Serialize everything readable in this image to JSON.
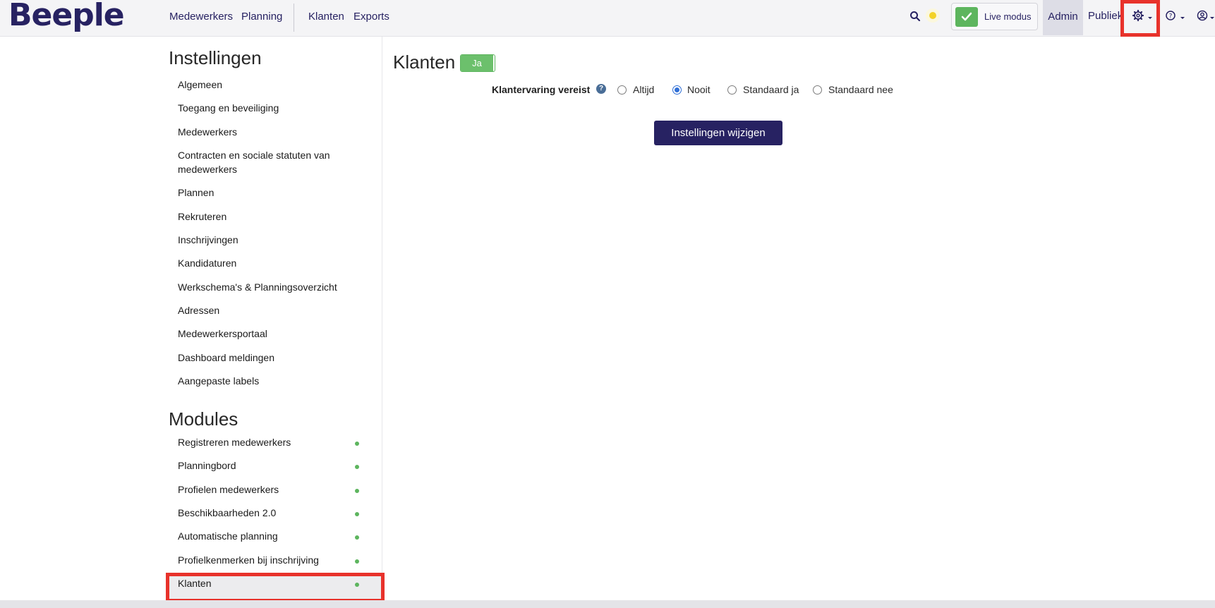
{
  "header": {
    "logo": "Beeple",
    "nav": [
      "Medewerkers",
      "Planning",
      "Klanten",
      "Exports"
    ],
    "live_mode_label": "Live modus",
    "admin_label": "Admin",
    "public_label": "Publiek",
    "icons": [
      "search-icon",
      "theme-indicator-icon",
      "check-icon",
      "gear-icon",
      "help-icon",
      "user-account-icon",
      "chevron-down-icon"
    ]
  },
  "sidebar": {
    "settings_heading": "Instellingen",
    "settings_items": [
      "Algemeen",
      "Toegang en beveiliging",
      "Medewerkers",
      "Contracten en sociale statuten van medewerkers",
      "Plannen",
      "Rekruteren",
      "Inschrijvingen",
      "Kandidaturen",
      "Werkschema's & Planningsoverzicht",
      "Adressen",
      "Medewerkersportaal",
      "Dashboard meldingen",
      "Aangepaste labels"
    ],
    "modules_heading": "Modules",
    "module_items": [
      "Registreren medewerkers",
      "Planningbord",
      "Profielen medewerkers",
      "Beschikbaarheden 2.0",
      "Automatische planning",
      "Profielkenmerken bij inschrijving",
      "Klanten"
    ],
    "active_item": "Klanten",
    "status_color": "#5db55e"
  },
  "main": {
    "title": "Klanten",
    "toggle_label": "Ja",
    "field_label": "Klantervaring vereist",
    "help_glyph": "?",
    "options": [
      "Altijd",
      "Nooit",
      "Standaard ja",
      "Standaard nee"
    ],
    "selected_option": "Nooit",
    "submit_label": "Instellingen wijzigen"
  },
  "colors": {
    "brand": "#272262",
    "accent_green": "#5db55e",
    "highlight_red": "#e8322b"
  }
}
